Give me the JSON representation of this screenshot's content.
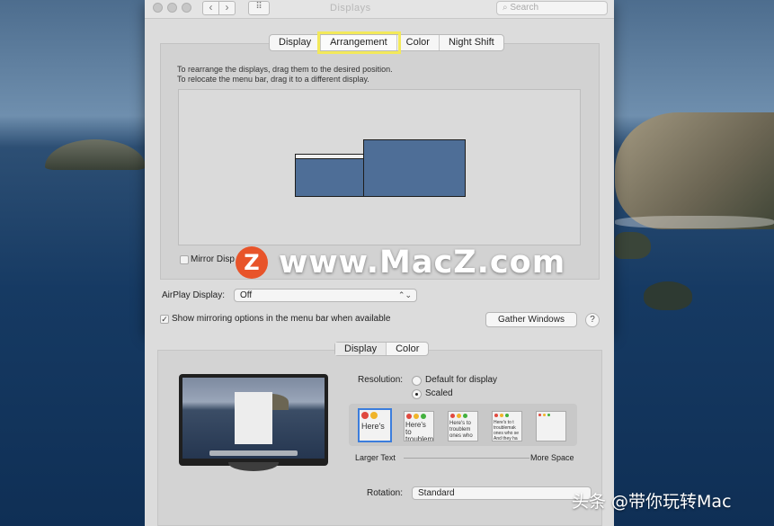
{
  "window": {
    "title": "Displays",
    "search_placeholder": "Search",
    "nav_back": "‹",
    "nav_forward": "›",
    "grid_glyph": "⠿"
  },
  "tabs": [
    {
      "label": "Display"
    },
    {
      "label": "Arrangement",
      "selected": true
    },
    {
      "label": "Color"
    },
    {
      "label": "Night Shift"
    }
  ],
  "arrangement": {
    "instruction_1": "To rearrange the displays, drag them to the desired position.",
    "instruction_2": "To relocate the menu bar, drag it to a different display.",
    "display_color": "#4e6e97"
  },
  "mirror": {
    "label": "Mirror Disp",
    "checked": false
  },
  "airplay": {
    "label": "AirPlay Display:",
    "value": "Off"
  },
  "show_mirroring": {
    "label": "Show mirroring options in the menu bar when available",
    "checked": true
  },
  "buttons": {
    "gather": "Gather Windows",
    "help": "?"
  },
  "watermark": {
    "logo": "Z",
    "text": "www.MacZ.com",
    "logo_color": "#e8542a"
  },
  "second_window": {
    "tabs": [
      {
        "label": "Display",
        "selected": true
      },
      {
        "label": "Color"
      }
    ],
    "resolution_label": "Resolution:",
    "resolution_options": [
      {
        "label": "Default for display",
        "selected": false
      },
      {
        "label": "Scaled",
        "selected": true
      }
    ],
    "thumbnails": [
      "Here's",
      "Here's to troublem",
      "Here's to troublem ones who",
      "Here's to t troublemak ones who se And they ha",
      ""
    ],
    "larger_text": "Larger Text",
    "more_space": "More Space",
    "rotation_label": "Rotation:",
    "rotation_value": "Standard"
  },
  "stamp": "头条 @带你玩转Mac"
}
